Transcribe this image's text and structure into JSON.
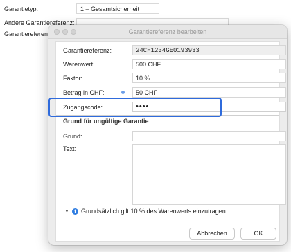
{
  "background_form": {
    "garantietyp_label": "Garantietyp:",
    "garantietyp_value": "1 – Gesamtsicherheit",
    "andere_label": "Andere Garantiereferenz:",
    "garantieref_label": "Garantiereferenz:"
  },
  "dialog": {
    "title": "Garantiereferenz bearbeiten",
    "fields": {
      "garantiereferenz_label": "Garantiereferenz:",
      "garantiereferenz_value": "24CH1234GE0193933",
      "warenwert_label": "Warenwert:",
      "warenwert_value": "500 CHF",
      "faktor_label": "Faktor:",
      "faktor_value": "10 %",
      "betrag_label": "Betrag in CHF:",
      "betrag_value": "50 CHF",
      "zugangscode_label": "Zugangscode:",
      "zugangscode_value": "••••"
    },
    "section": {
      "title": "Grund für ungültige Garantie",
      "grund_label": "Grund:",
      "grund_value": "",
      "text_label": "Text:"
    },
    "info_text": "Grundsätzlich gilt 10 % des Warenwerts einzutragen.",
    "buttons": {
      "cancel": "Abbrechen",
      "ok": "OK"
    }
  },
  "colors": {
    "highlight": "#2f6bdc",
    "info_icon": "#2f7de1"
  },
  "icons": {
    "disclosure": "disclosure-triangle-icon",
    "info": "info-icon"
  }
}
